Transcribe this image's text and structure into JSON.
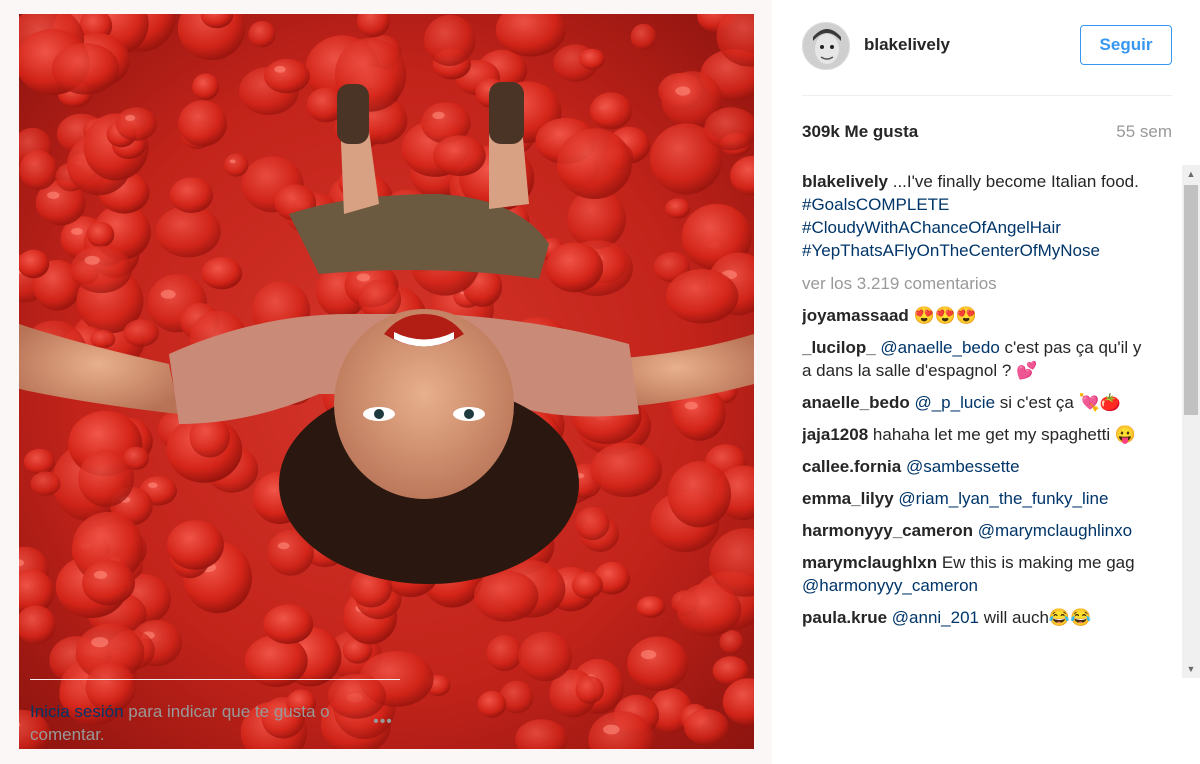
{
  "post": {
    "username": "blakelively",
    "follow_label": "Seguir",
    "likes": "309k Me gusta",
    "time": "55 sem",
    "caption": {
      "user": "blakelively",
      "text": " ...I've finally become Italian food. ",
      "tags": [
        "#GoalsCOMPLETE",
        "#CloudyWithAChanceOfAngelHair",
        "#YepThatsAFlyOnTheCenterOfMyNose"
      ]
    },
    "view_all": "ver los 3.219 comentarios"
  },
  "comments": [
    {
      "user": "joyamassaad",
      "parts": [
        {
          "t": " 😍😍😍"
        }
      ]
    },
    {
      "user": "_lucilop_",
      "parts": [
        {
          "t": " "
        },
        {
          "t": "@anaelle_bedo",
          "link": true
        },
        {
          "t": " c'est pas ça qu'il y a dans la salle d'espagnol ? 💕"
        }
      ]
    },
    {
      "user": "anaelle_bedo",
      "parts": [
        {
          "t": " "
        },
        {
          "t": "@_p_lucie",
          "link": true
        },
        {
          "t": " si c'est ça 💘🍅"
        }
      ]
    },
    {
      "user": "jaja1208",
      "parts": [
        {
          "t": " hahaha let me get my spaghetti 😛"
        }
      ]
    },
    {
      "user": "callee.fornia",
      "parts": [
        {
          "t": " "
        },
        {
          "t": "@sambessette",
          "link": true
        }
      ]
    },
    {
      "user": "emma_lilyy",
      "parts": [
        {
          "t": " "
        },
        {
          "t": "@riam_lyan_the_funky_line",
          "link": true
        }
      ]
    },
    {
      "user": "harmonyyy_cameron",
      "parts": [
        {
          "t": " "
        },
        {
          "t": "@marymclaughlinxo",
          "link": true
        }
      ]
    },
    {
      "user": "marymclaughlxn",
      "parts": [
        {
          "t": " Ew this is making me gag "
        },
        {
          "t": "@harmonyyy_cameron",
          "link": true
        }
      ]
    },
    {
      "user": "paula.krue",
      "parts": [
        {
          "t": " "
        },
        {
          "t": "@anni_201",
          "link": true
        },
        {
          "t": " will auch😂😂"
        }
      ]
    }
  ],
  "footer": {
    "login_label": "Inicia sesión",
    "text": " para indicar que te gusta o comentar."
  },
  "icons": {
    "more": "more-options-icon",
    "scroll_up": "scroll-up-icon",
    "scroll_down": "scroll-down-icon"
  },
  "colors": {
    "link": "#003569",
    "accent": "#3897f0",
    "muted": "#999999"
  }
}
